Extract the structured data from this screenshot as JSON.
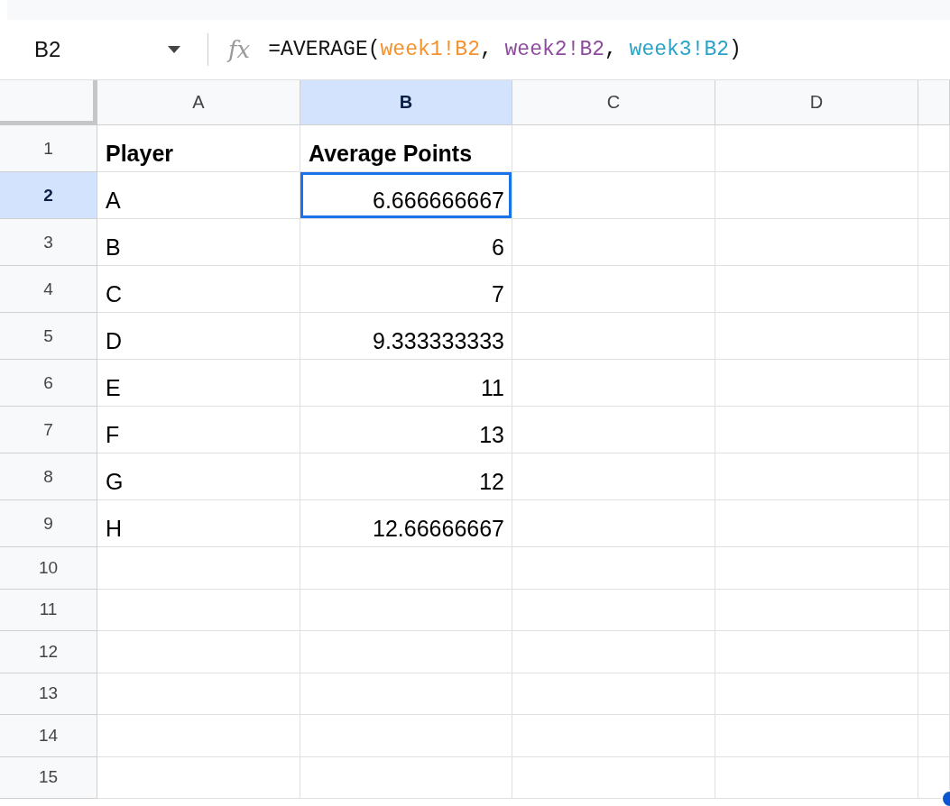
{
  "formula_bar": {
    "name_box": "B2",
    "function_label": "fx",
    "formula_parts": [
      {
        "text": "=AVERAGE("
      },
      {
        "text": "week1!B2",
        "color": "#f4922f"
      },
      {
        "text": ", "
      },
      {
        "text": "week2!B2",
        "color": "#8e4c9e"
      },
      {
        "text": ", "
      },
      {
        "text": "week3!B2",
        "color": "#2aa3c8"
      },
      {
        "text": ")"
      }
    ]
  },
  "columns": [
    {
      "label": "A",
      "selected": false
    },
    {
      "label": "B",
      "selected": true
    },
    {
      "label": "C",
      "selected": false
    },
    {
      "label": "D",
      "selected": false
    }
  ],
  "rows": [
    {
      "number": "1",
      "selected": false,
      "cells": [
        {
          "text": "Player",
          "kind": "text",
          "bold": true,
          "selected": false
        },
        {
          "text": "Average Points",
          "kind": "text",
          "bold": true,
          "selected": false
        }
      ]
    },
    {
      "number": "2",
      "selected": true,
      "cells": [
        {
          "text": "A",
          "kind": "text",
          "bold": false,
          "selected": false
        },
        {
          "text": "6.666666667",
          "kind": "number",
          "bold": false,
          "selected": true
        }
      ]
    },
    {
      "number": "3",
      "selected": false,
      "cells": [
        {
          "text": "B",
          "kind": "text",
          "bold": false,
          "selected": false
        },
        {
          "text": "6",
          "kind": "number",
          "bold": false,
          "selected": false
        }
      ]
    },
    {
      "number": "4",
      "selected": false,
      "cells": [
        {
          "text": "C",
          "kind": "text",
          "bold": false,
          "selected": false
        },
        {
          "text": "7",
          "kind": "number",
          "bold": false,
          "selected": false
        }
      ]
    },
    {
      "number": "5",
      "selected": false,
      "cells": [
        {
          "text": "D",
          "kind": "text",
          "bold": false,
          "selected": false
        },
        {
          "text": "9.333333333",
          "kind": "number",
          "bold": false,
          "selected": false
        }
      ]
    },
    {
      "number": "6",
      "selected": false,
      "cells": [
        {
          "text": "E",
          "kind": "text",
          "bold": false,
          "selected": false
        },
        {
          "text": "11",
          "kind": "number",
          "bold": false,
          "selected": false
        }
      ]
    },
    {
      "number": "7",
      "selected": false,
      "cells": [
        {
          "text": "F",
          "kind": "text",
          "bold": false,
          "selected": false
        },
        {
          "text": "13",
          "kind": "number",
          "bold": false,
          "selected": false
        }
      ]
    },
    {
      "number": "8",
      "selected": false,
      "cells": [
        {
          "text": "G",
          "kind": "text",
          "bold": false,
          "selected": false
        },
        {
          "text": "12",
          "kind": "number",
          "bold": false,
          "selected": false
        }
      ]
    },
    {
      "number": "9",
      "selected": false,
      "cells": [
        {
          "text": "H",
          "kind": "text",
          "bold": false,
          "selected": false
        },
        {
          "text": "12.66666667",
          "kind": "number",
          "bold": false,
          "selected": false
        }
      ]
    },
    {
      "number": "10",
      "selected": false
    },
    {
      "number": "11",
      "selected": false
    },
    {
      "number": "12",
      "selected": false
    },
    {
      "number": "13",
      "selected": false
    },
    {
      "number": "14",
      "selected": false
    },
    {
      "number": "15",
      "selected": false
    }
  ]
}
